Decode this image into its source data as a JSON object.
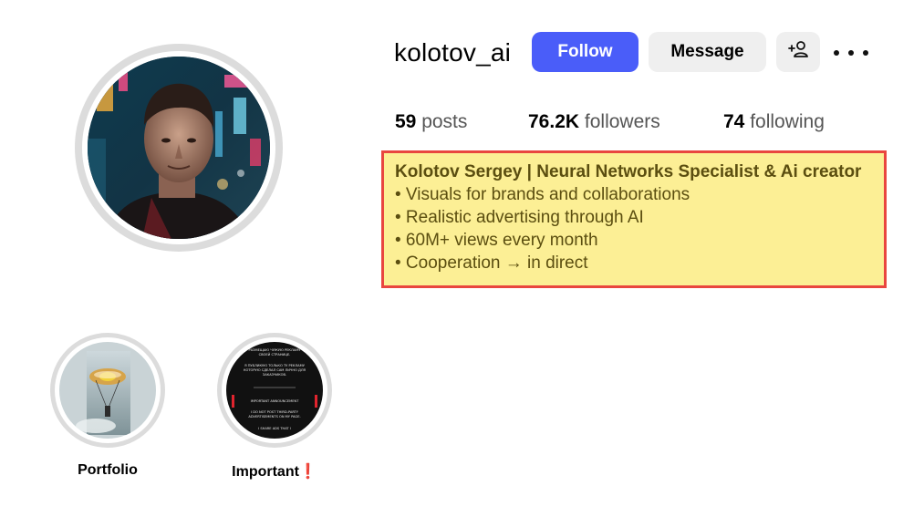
{
  "profile": {
    "username": "kolotov_ai",
    "follow_label": "Follow",
    "message_label": "Message",
    "add_user_icon": "add-user-icon",
    "more_icon": "more-horizontal-icon"
  },
  "stats": {
    "posts_count": "59",
    "posts_label": "posts",
    "followers_count": "76.2K",
    "followers_label": "followers",
    "following_count": "74",
    "following_label": "following"
  },
  "bio": {
    "name_line": "Kolotov Sergey | Neural Networks Specialist & Ai creator",
    "lines": [
      "• Visuals for brands and collaborations",
      "• Realistic advertising through AI",
      "• 60M+ views every month",
      "• Cooperation → in direct"
    ]
  },
  "highlights": [
    {
      "label": "Portfolio"
    },
    {
      "label": "Important",
      "suffix": "❗"
    }
  ],
  "important_story_text": [
    "РАЗМЕЩАЮ ЧУЖУЮ РЕКЛАМУ",
    "СВОЕЙ СТРАНИЦЕ.",
    "Я ПУБЛИКУЮ ТОЛЬКО ТУ РЕКЛАМУ",
    "КОТОРУЮ СДЕЛАЛ САМ ЛИЧНО ДЛЯ",
    "ЗАКАЗЧИКОВ.",
    "IMPORTANT ANNOUNCEMENT",
    "I DO NOT POST THIRD-PARTY",
    "ADVERTISEMENTS ON MY PAGE.",
    "I SHARE ADS THAT I"
  ],
  "colors": {
    "follow_bg": "#4a5df9",
    "secondary_btn_bg": "#efefef",
    "bio_highlight_bg": "#fcef95",
    "bio_highlight_border": "#e9463f",
    "bio_text": "#5b4e10"
  }
}
